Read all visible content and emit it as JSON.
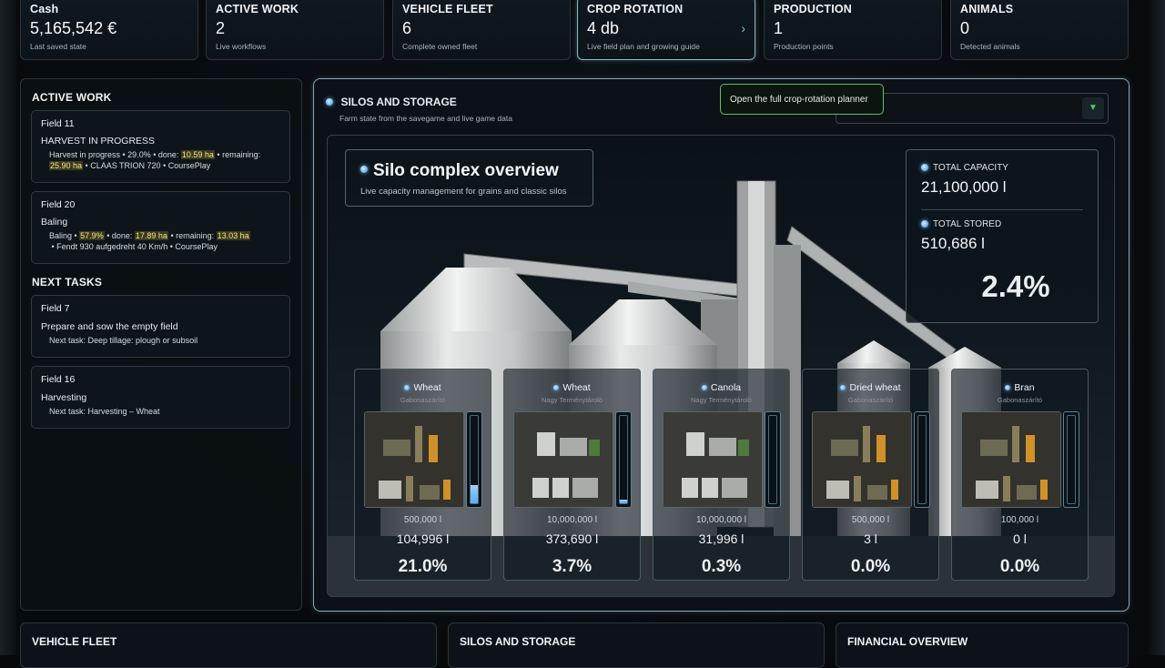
{
  "stats": [
    {
      "title": "Cash",
      "value": "5,165,542 €",
      "sub": "Last saved state",
      "active": false
    },
    {
      "title": "ACTIVE WORK",
      "value": "2",
      "sub": "Live workflows",
      "active": false
    },
    {
      "title": "VEHICLE FLEET",
      "value": "6",
      "sub": "Complete owned fleet",
      "active": false
    },
    {
      "title": "CROP ROTATION",
      "value": "4 db",
      "sub": "Live field plan and growing guide",
      "active": true,
      "chevron": "›"
    },
    {
      "title": "PRODUCTION",
      "value": "1",
      "sub": "Production points",
      "active": false
    },
    {
      "title": "ANIMALS",
      "value": "0",
      "sub": "Detected animals",
      "active": false
    }
  ],
  "left": {
    "active_title": "ACTIVE WORK",
    "active": [
      {
        "field": "Field 11",
        "status": "HARVEST IN PROGRESS",
        "line1_a": "Harvest in progress • 29.0% • done: ",
        "line1_done": "10.59 ha",
        "line1_b": " • remaining:",
        "line2_rem": "25.90 ha",
        "line2_b": " • CLAAS TRION 720 • CoursePlay"
      },
      {
        "field": "Field 20",
        "status": "Baling",
        "line1_a": "Baling • ",
        "line1_pct": "57.9%",
        "line1_b": " • done: ",
        "line1_done": "17.89 ha",
        "line1_c": " • remaining: ",
        "line1_rem": "13.03 ha",
        "line2": "• Fendt 930 aufgedreht 40 Km/h • CoursePlay"
      }
    ],
    "next_title": "NEXT TASKS",
    "next": [
      {
        "field": "Field 7",
        "status": "Prepare and sow the empty field",
        "detail": "Next task: Deep tillage: plough or subsoil"
      },
      {
        "field": "Field 16",
        "status": "Harvesting",
        "detail": "Next task: Harvesting – Wheat"
      }
    ]
  },
  "main": {
    "title": "SILOS AND STORAGE",
    "subtitle": "Farm state from the savegame and live game data",
    "tooltip": "Open the full crop-rotation planner",
    "select_value": "",
    "overview_title": "Silo complex overview",
    "overview_sub": "Live capacity management for grains and classic silos",
    "total_capacity_label": "TOTAL CAPACITY",
    "total_capacity": "21,100,000 l",
    "total_stored_label": "TOTAL STORED",
    "total_stored": "510,686 l",
    "total_pct": "2.4%",
    "silos": [
      {
        "name": "Wheat",
        "location": "Gabonaszárító",
        "capacity": "500,000 l",
        "stored": "104,996 l",
        "pct": "21.0%",
        "fill": 0.21,
        "img": "dryer"
      },
      {
        "name": "Wheat",
        "location": "Nagy Terménytároló",
        "capacity": "10,000,000 l",
        "stored": "373,690 l",
        "pct": "3.7%",
        "fill": 0.037,
        "img": "bins"
      },
      {
        "name": "Canola",
        "location": "Nagy Terménytároló",
        "capacity": "10,000,000 l",
        "stored": "31,996 l",
        "pct": "0.3%",
        "fill": 0.003,
        "img": "bins"
      },
      {
        "name": "Dried wheat",
        "location": "Gabonaszárító",
        "capacity": "500,000 l",
        "stored": "3 l",
        "pct": "0.0%",
        "fill": 0.0,
        "img": "dryer"
      },
      {
        "name": "Bran",
        "location": "Gabonaszárító",
        "capacity": "100,000 l",
        "stored": "0 l",
        "pct": "0.0%",
        "fill": 0.0,
        "img": "dryer"
      }
    ]
  },
  "bottom": [
    {
      "title": "VEHICLE FLEET"
    },
    {
      "title": "SILOS AND STORAGE"
    },
    {
      "title": "FINANCIAL OVERVIEW"
    }
  ]
}
